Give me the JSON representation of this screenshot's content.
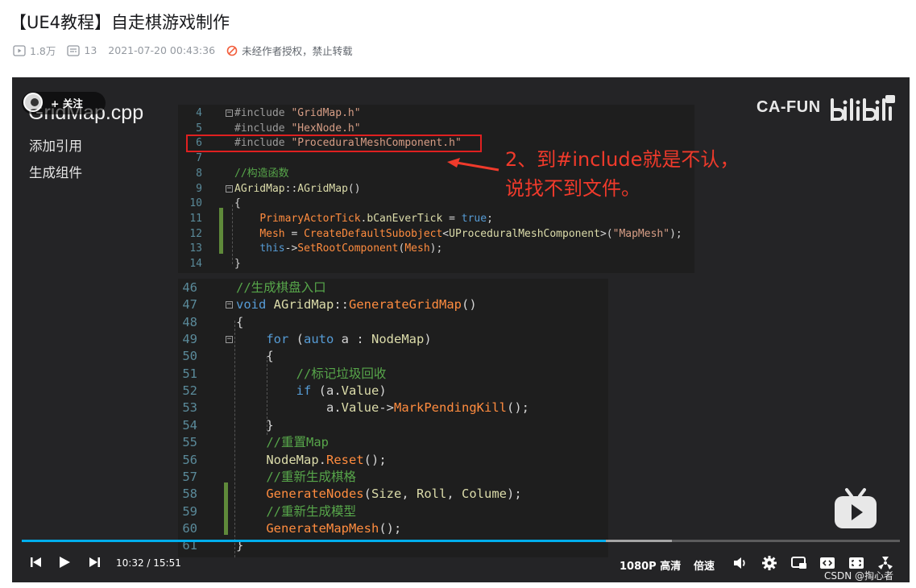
{
  "page": {
    "title": "【UE4教程】自走棋游戏制作",
    "meta": {
      "views": "1.8万",
      "danmaku": "13",
      "datetime": "2021-07-20 00:43:36",
      "copyright": "未经作者授权，禁止转载"
    }
  },
  "player": {
    "follow": "+ 关注",
    "side_title": "GridMap.cpp",
    "side_items": [
      "添加引用",
      "生成组件"
    ],
    "brand": "CA-FUN",
    "annotation": [
      "2、到#include就是不认，",
      "说找不到文件。"
    ],
    "code_top": [
      {
        "n": "4",
        "t": "#include \"GridMap.h\""
      },
      {
        "n": "5",
        "t": "#include \"HexNode.h\""
      },
      {
        "n": "6",
        "t": "#include \"ProceduralMeshComponent.h\""
      },
      {
        "n": "7",
        "t": ""
      },
      {
        "n": "8",
        "t": "//构造函数"
      },
      {
        "n": "9",
        "t": "AGridMap::AGridMap()"
      },
      {
        "n": "10",
        "t": "{"
      },
      {
        "n": "11",
        "t": "    PrimaryActorTick.bCanEverTick = true;"
      },
      {
        "n": "12",
        "t": "    Mesh = CreateDefaultSubobject<UProceduralMeshComponent>(\"MapMesh\");"
      },
      {
        "n": "13",
        "t": "    this->SetRootComponent(Mesh);"
      },
      {
        "n": "14",
        "t": "}"
      }
    ],
    "code_bottom": [
      {
        "n": "46",
        "t": "//生成棋盘入口"
      },
      {
        "n": "47",
        "t": "void AGridMap::GenerateGridMap()"
      },
      {
        "n": "48",
        "t": "{"
      },
      {
        "n": "49",
        "t": "    for (auto a : NodeMap)"
      },
      {
        "n": "50",
        "t": "    {"
      },
      {
        "n": "51",
        "t": "        //标记垃圾回收"
      },
      {
        "n": "52",
        "t": "        if (a.Value)"
      },
      {
        "n": "53",
        "t": "            a.Value->MarkPendingKill();"
      },
      {
        "n": "54",
        "t": "    }"
      },
      {
        "n": "55",
        "t": "    //重置Map"
      },
      {
        "n": "56",
        "t": "    NodeMap.Reset();"
      },
      {
        "n": "57",
        "t": "    //重新生成棋格"
      },
      {
        "n": "58",
        "t": "    GenerateNodes(Size, Roll, Colume);"
      },
      {
        "n": "59",
        "t": "    //重新生成模型"
      },
      {
        "n": "60",
        "t": "    GenerateMapMesh();"
      },
      {
        "n": "61",
        "t": "}"
      }
    ],
    "current_time": "10:32",
    "duration": "15:51",
    "progress": 0.665,
    "buffered": 0.74,
    "quality": "1080P 高清",
    "speed": "倍速",
    "watermark": "CSDN @掏心者"
  }
}
